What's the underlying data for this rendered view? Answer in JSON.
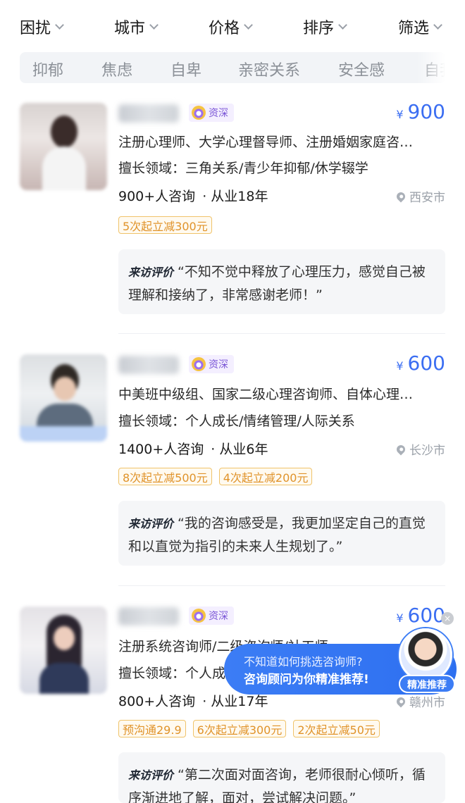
{
  "filters": [
    {
      "label": "困扰"
    },
    {
      "label": "城市"
    },
    {
      "label": "价格"
    },
    {
      "label": "排序"
    },
    {
      "label": "筛选"
    }
  ],
  "tags": [
    "抑郁",
    "焦虑",
    "自卑",
    "亲密关系",
    "安全感",
    "自我"
  ],
  "badge_text": "资深",
  "currency": "¥",
  "review_label": "来访评价",
  "counselors": [
    {
      "price": "900",
      "quals": "注册心理师、大学心理督导师、注册婚姻家庭咨…",
      "field": "擅长领域：三角关系/青少年抑郁/休学辍学",
      "consults": "900+人咨询",
      "experience": "· 从业18年",
      "city": "西安市",
      "promos": [
        "5次起立减300元"
      ],
      "review": "“不知不觉中释放了心理压力，感觉自己被理解和接纳了，非常感谢老师！”"
    },
    {
      "price": "600",
      "quals": "中美班中级组、国家二级心理咨询师、自体心理…",
      "field": "擅长领域：个人成长/情绪管理/人际关系",
      "consults": "1400+人咨询",
      "experience": "· 从业6年",
      "city": "长沙市",
      "promos": [
        "8次起立减500元",
        "4次起立减200元"
      ],
      "review": "“我的咨询感受是，我更加坚定自己的直觉和以直觉为指引的未来人生规划了。”"
    },
    {
      "price": "600",
      "quals": "注册系统咨询师/二级咨询师/社工师",
      "field": "擅长领域：个人成长",
      "consults": "800+人咨询",
      "experience": "· 从业17年",
      "city": "赣州市",
      "promos": [
        "预沟通29.9",
        "6次起立减300元",
        "2次起立减50元"
      ],
      "review": "“第二次面对面咨询，老师很耐心倾听，循序渐进地了解，面对，尝试解决问题。”"
    }
  ],
  "float_banner": {
    "line1": "不知道如何挑选咨询师?",
    "line2": "咨询顾问为你精准推荐!",
    "tag": "精准推荐",
    "close": "×"
  },
  "colors": {
    "accent": "#3b6ef2",
    "promo": "#e0932a",
    "badge": "#7a55d6"
  }
}
